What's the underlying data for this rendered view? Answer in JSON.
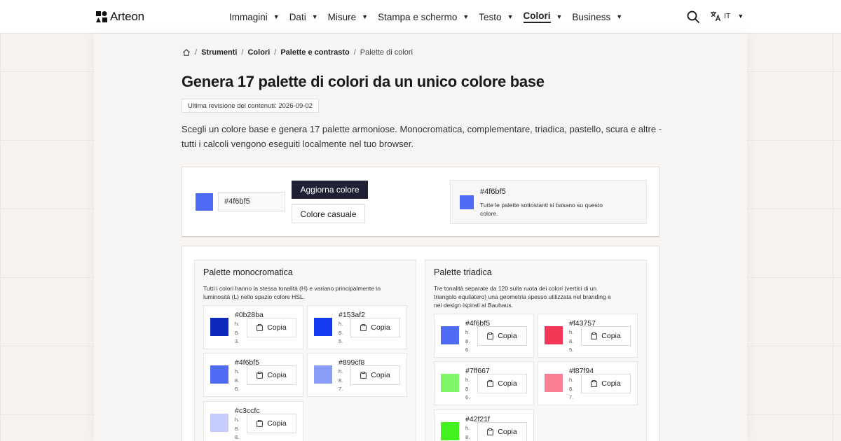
{
  "header": {
    "logo_text": "Arteon",
    "nav": [
      {
        "label": "Immagini",
        "active": false
      },
      {
        "label": "Dati",
        "active": false
      },
      {
        "label": "Misure",
        "active": false
      },
      {
        "label": "Stampa e schermo",
        "active": false
      },
      {
        "label": "Testo",
        "active": false
      },
      {
        "label": "Colori",
        "active": true
      },
      {
        "label": "Business",
        "active": false
      }
    ],
    "lang": "IT"
  },
  "breadcrumb": {
    "items": [
      "Strumenti",
      "Colori",
      "Palette e contrasto"
    ],
    "current": "Palette di colori"
  },
  "page": {
    "title": "Genera 17 palette di colori da un unico colore base",
    "revision": "Ultima revisione dei contenuti: 2026-09-02",
    "intro": "Scegli un colore base e genera 17 palette armoniose. Monocromatica, complementare, triadica, pastello, scura e altre - tutti i calcoli vengono eseguiti localmente nel tuo browser."
  },
  "input": {
    "value": "#4f6bf5",
    "update_label": "Aggiorna colore",
    "random_label": "Colore casuale",
    "base_hex": "#4f6bf5",
    "base_desc": "Tutte le palette sottostanti si basano su questo colore."
  },
  "palettes": {
    "mono": {
      "title": "Palette monocromatica",
      "desc_line1": "Tutti i colori hanno la stessa tonalità (H) e variano principalmente in",
      "desc_line2": "luminosità (L) nello spazio colore HSL.",
      "colors": [
        {
          "hex": "#0b28ba",
          "meta": [
            "h.",
            "8.",
            "3."
          ],
          "color": "#0b28ba"
        },
        {
          "hex": "#153af2",
          "meta": [
            "h.",
            "8.",
            "5."
          ],
          "color": "#153af2"
        },
        {
          "hex": "#4f6bf5",
          "meta": [
            "h.",
            "8.",
            "6."
          ],
          "color": "#4f6bf5"
        },
        {
          "hex": "#899cf8",
          "meta": [
            "h.",
            "8.",
            "7."
          ],
          "color": "#899cf8"
        },
        {
          "hex": "#c3ccfc",
          "meta": [
            "h.",
            "8.",
            "8."
          ],
          "color": "#c3ccfc"
        }
      ]
    },
    "triad": {
      "title": "Palette triadica",
      "desc_line1": "Tre tonalità separate da 120 sulla ruota dei colori (vertici di un",
      "desc_line2": "triangolo equilatero) una geometria spesso utilizzata nel branding e",
      "desc_line3": "nei design ispirati al Bauhaus.",
      "colors": [
        {
          "hex": "#4f6bf5",
          "meta": [
            "h.",
            "8.",
            "6."
          ],
          "color": "#4f6bf5"
        },
        {
          "hex": "#f43757",
          "meta": [
            "h.",
            "8.",
            "5."
          ],
          "color": "#f43757"
        },
        {
          "hex": "#7ff667",
          "meta": [
            "h.",
            "8.",
            "6."
          ],
          "color": "#7ff667"
        },
        {
          "hex": "#f87f94",
          "meta": [
            "h.",
            "8.",
            "7."
          ],
          "color": "#f87f94"
        },
        {
          "hex": "#42f21f",
          "meta": [
            "h.",
            "8."
          ],
          "color": "#42f21f"
        }
      ]
    },
    "copy_label": "Copia"
  }
}
